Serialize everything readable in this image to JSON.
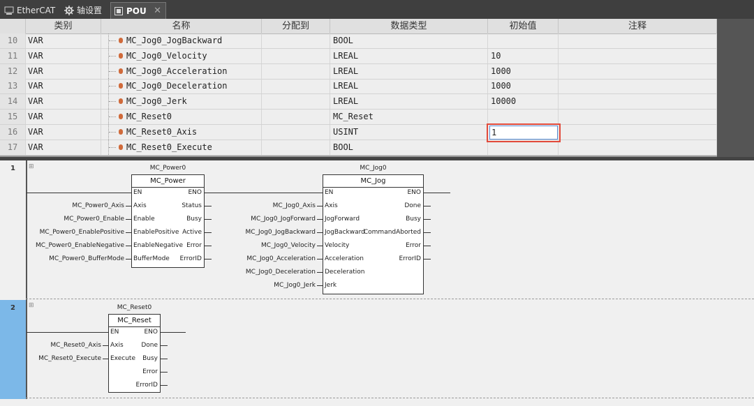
{
  "tabs": [
    {
      "label": "EtherCAT",
      "icon": "network-icon"
    },
    {
      "label": "轴设置",
      "icon": "gear-icon"
    },
    {
      "label": "POU",
      "icon": "pou-icon",
      "close": "✕"
    }
  ],
  "var_table": {
    "headers": [
      "类别",
      "名称",
      "分配到",
      "数据类型",
      "初始值",
      "注释"
    ],
    "rows": [
      {
        "num": "10",
        "kind": "VAR",
        "name": "MC_Jog0_JogBackward",
        "type": "BOOL",
        "init": ""
      },
      {
        "num": "11",
        "kind": "VAR",
        "name": "MC_Jog0_Velocity",
        "type": "LREAL",
        "init": "10"
      },
      {
        "num": "12",
        "kind": "VAR",
        "name": "MC_Jog0_Acceleration",
        "type": "LREAL",
        "init": "1000"
      },
      {
        "num": "13",
        "kind": "VAR",
        "name": "MC_Jog0_Deceleration",
        "type": "LREAL",
        "init": "1000"
      },
      {
        "num": "14",
        "kind": "VAR",
        "name": "MC_Jog0_Jerk",
        "type": "LREAL",
        "init": "10000"
      },
      {
        "num": "15",
        "kind": "VAR",
        "name": "MC_Reset0",
        "type": "MC_Reset",
        "init": ""
      },
      {
        "num": "16",
        "kind": "VAR",
        "name": "MC_Reset0_Axis",
        "type": "USINT",
        "init": ""
      },
      {
        "num": "17",
        "kind": "VAR",
        "name": "MC_Reset0_Execute",
        "type": "BOOL",
        "init": ""
      }
    ],
    "editing_value": "1"
  },
  "ladder": {
    "networks": [
      {
        "number": "1"
      },
      {
        "number": "2"
      }
    ],
    "mc_power": {
      "instance": "MC_Power0",
      "type": "MC_Power",
      "inputs": [
        "EN",
        "Axis",
        "Enable",
        "EnablePositive",
        "EnableNegative",
        "BufferMode"
      ],
      "outputs": [
        "ENO",
        "Status",
        "Busy",
        "Active",
        "Error",
        "ErrorID"
      ],
      "in_vars": [
        "MC_Power0_Axis",
        "MC_Power0_Enable",
        "MC_Power0_EnablePositive",
        "MC_Power0_EnableNegative",
        "MC_Power0_BufferMode"
      ]
    },
    "mc_jog": {
      "instance": "MC_Jog0",
      "type": "MC_Jog",
      "inputs": [
        "EN",
        "Axis",
        "JogForward",
        "JogBackward",
        "Velocity",
        "Acceleration",
        "Deceleration",
        "Jerk"
      ],
      "outputs": [
        "ENO",
        "Done",
        "Busy",
        "CommandAborted",
        "Error",
        "ErrorID"
      ],
      "in_vars": [
        "MC_Jog0_Axis",
        "MC_Jog0_JogForward",
        "MC_Jog0_JogBackward",
        "MC_Jog0_Velocity",
        "MC_Jog0_Acceleration",
        "MC_Jog0_Deceleration",
        "MC_Jog0_Jerk"
      ]
    },
    "mc_reset": {
      "instance": "MC_Reset0",
      "type": "MC_Reset",
      "inputs": [
        "EN",
        "Axis",
        "Execute"
      ],
      "outputs": [
        "ENO",
        "Done",
        "Busy",
        "Error",
        "ErrorID"
      ],
      "in_vars": [
        "MC_Reset0_Axis",
        "MC_Reset0_Execute"
      ]
    }
  }
}
